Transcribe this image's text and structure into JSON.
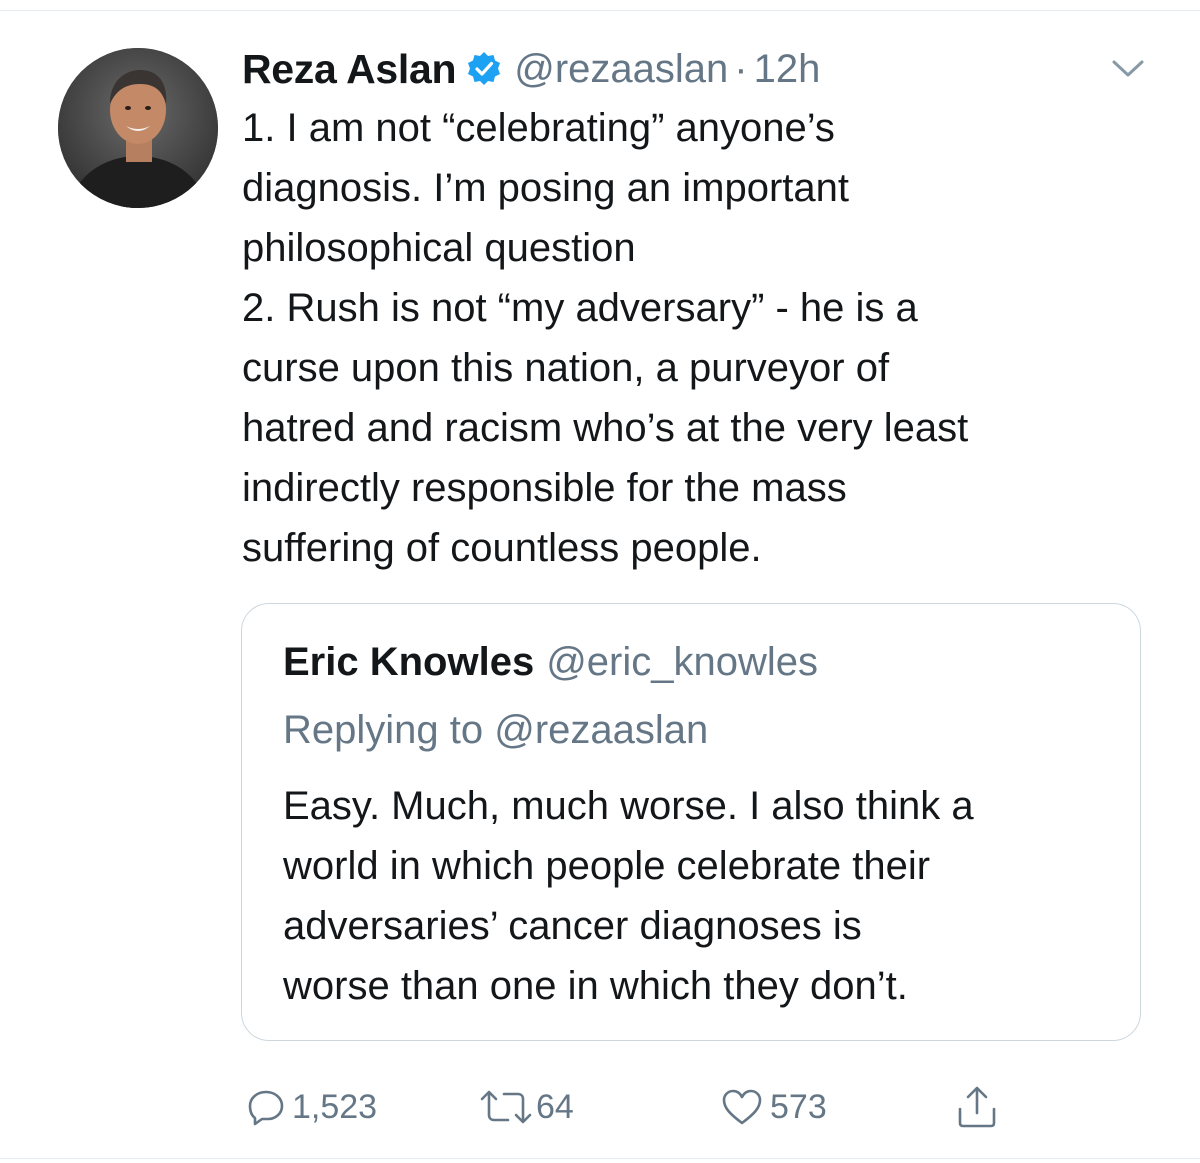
{
  "tweet": {
    "author": {
      "display_name": "Reza Aslan",
      "handle": "@rezaaslan",
      "verified": true,
      "avatar_icon": "profile-photo"
    },
    "separator": "·",
    "timestamp": "12h",
    "menu_icon": "chevron-down-icon",
    "text_lines": [
      "1. I am not “celebrating” anyone’s",
      "diagnosis. I’m posing an important",
      "philosophical question",
      "2. Rush is not “my adversary” - he is a",
      "curse upon this nation, a purveyor of",
      "hatred and racism who’s at the very least",
      "indirectly responsible for the mass",
      "suffering of countless people."
    ]
  },
  "quoted_tweet": {
    "display_name": "Eric Knowles",
    "handle": "@eric_knowles",
    "replying_prefix": "Replying to",
    "replying_handle": "@rezaaslan",
    "text_lines": [
      "Easy. Much, much worse. I also think a",
      "world in which people celebrate their",
      "adversaries’ cancer diagnoses is",
      "worse than one in which they don’t."
    ]
  },
  "actions": {
    "reply": {
      "icon": "reply-icon",
      "count": "1,523"
    },
    "retweet": {
      "icon": "retweet-icon",
      "count": "64"
    },
    "like": {
      "icon": "heart-icon",
      "count": "573"
    },
    "share": {
      "icon": "share-icon"
    }
  },
  "colors": {
    "text": "#14171a",
    "secondary": "#657786",
    "verified_blue": "#1da1f2",
    "border": "#ccd6dd"
  }
}
